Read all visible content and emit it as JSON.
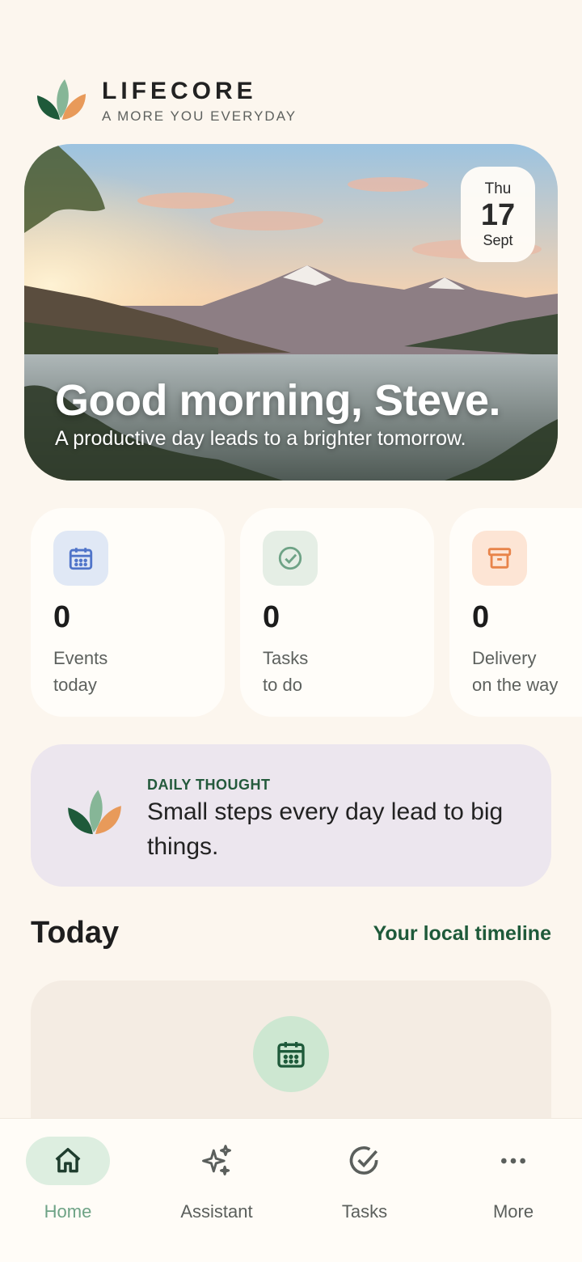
{
  "brand": {
    "name": "LIFECORE",
    "tagline": "A MORE YOU EVERYDAY",
    "colors": {
      "leaf_dark": "#1e5a3a",
      "leaf_mid": "#7bb08c",
      "leaf_orange": "#e89a5a"
    }
  },
  "hero": {
    "date_day": "Thu",
    "date_number": "17",
    "date_month": "Sept",
    "greeting": "Good morning, Steve.",
    "subtitle": "A productive day leads to a brighter tomorrow."
  },
  "stats": [
    {
      "icon": "calendar-icon",
      "value": "0",
      "label": "Events\ntoday",
      "icon_bg": "#e0e8f5",
      "icon_color": "#4f74c9"
    },
    {
      "icon": "check-circle-icon",
      "value": "0",
      "label": "Tasks\nto do",
      "icon_bg": "#e5eee5",
      "icon_color": "#6ea386"
    },
    {
      "icon": "archive-box-icon",
      "value": "0",
      "label": "Delivery\non the way",
      "icon_bg": "#fde5d5",
      "icon_color": "#e8844a"
    }
  ],
  "daily_thought": {
    "title": "DAILY THOUGHT",
    "text": "Small steps every day lead to big things."
  },
  "today": {
    "title": "Today",
    "link": "Your local timeline"
  },
  "nav": [
    {
      "label": "Home",
      "icon": "home-icon",
      "active": true
    },
    {
      "label": "Assistant",
      "icon": "sparkle-icon",
      "active": false
    },
    {
      "label": "Tasks",
      "icon": "check-circle-icon",
      "active": false
    },
    {
      "label": "More",
      "icon": "more-dots-icon",
      "active": false
    }
  ]
}
